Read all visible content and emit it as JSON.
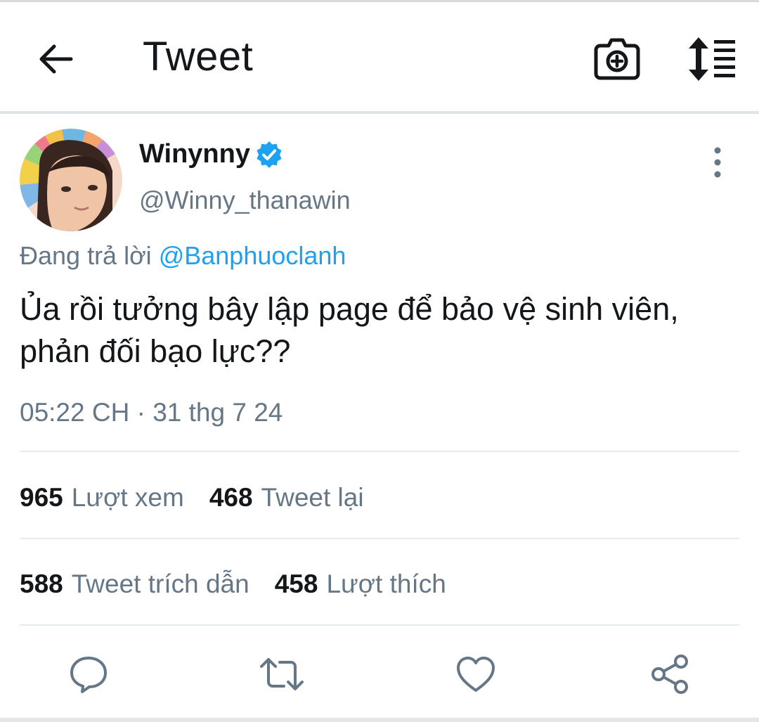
{
  "header": {
    "title": "Tweet",
    "back_icon": "arrow-left-icon",
    "camera_icon": "camera-add-icon",
    "sort_icon": "sort-list-icon"
  },
  "tweet": {
    "display_name": "Winynny",
    "handle": "@Winny_thanawin",
    "verified": true,
    "reply_prefix": "Đang trả lời",
    "reply_mention": "@Banphuoclanh",
    "text_line1": "Ủa rồi tưởng bây lập page để bảo vệ sinh viên,",
    "text_line2": "phản đối bạo lực??",
    "timestamp": "05:22 CH · 31 thg 7 24"
  },
  "stats": {
    "views": {
      "count": "965",
      "label": "Lượt xem"
    },
    "retweets": {
      "count": "468",
      "label": "Tweet lại"
    },
    "quotes": {
      "count": "588",
      "label": "Tweet trích dẫn"
    },
    "likes": {
      "count": "458",
      "label": "Lượt thích"
    }
  },
  "actions": [
    "reply-icon",
    "retweet-icon",
    "like-icon",
    "share-icon"
  ],
  "colors": {
    "accent": "#1da1f2",
    "text_primary": "#14171a",
    "text_secondary": "#657786",
    "divider": "#e6ecf0"
  }
}
